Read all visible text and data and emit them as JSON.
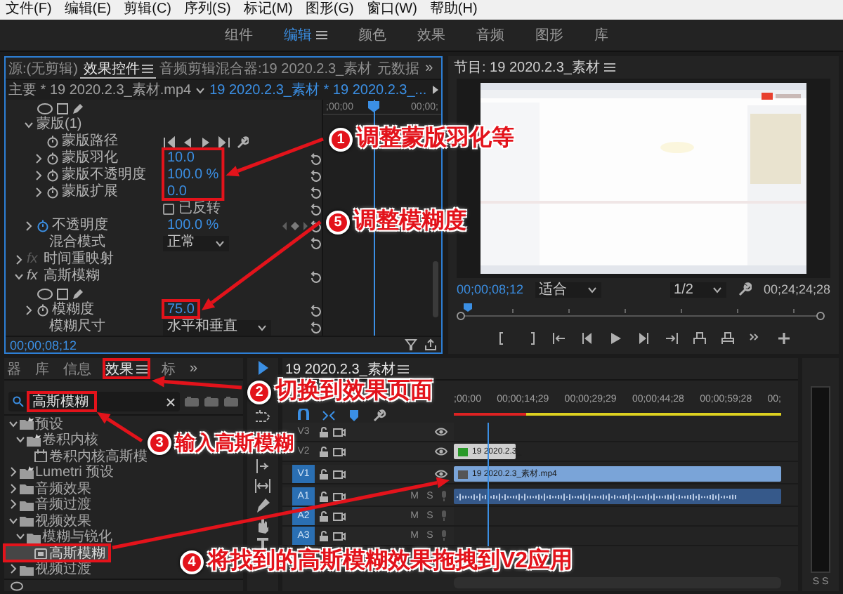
{
  "menu_bar": [
    "文件(F)",
    "编辑(E)",
    "剪辑(C)",
    "序列(S)",
    "标记(M)",
    "图形(G)",
    "窗口(W)",
    "帮助(H)"
  ],
  "workspaces": [
    {
      "label": "组件",
      "selected": false
    },
    {
      "label": "编辑",
      "selected": true
    },
    {
      "label": "颜色",
      "selected": false
    },
    {
      "label": "效果",
      "selected": false
    },
    {
      "label": "音频",
      "selected": false
    },
    {
      "label": "图形",
      "selected": false
    },
    {
      "label": "库",
      "selected": false
    }
  ],
  "effect_controls": {
    "tabs": [
      {
        "label": "源:(无剪辑)",
        "selected": false
      },
      {
        "label": "效果控件",
        "selected": true
      },
      {
        "label": "音频剪辑混合器:19 2020.2.3_素材",
        "selected": false
      },
      {
        "label": "元数据",
        "selected": false
      }
    ],
    "overflow": "»",
    "master_clip": "主要 * 19 2020.2.3_素材.mp4",
    "sequence_clip": "19 2020.2.3_素材 * 19 2020.2.3_...",
    "ruler": [
      ";00;00",
      "00;00;"
    ],
    "effects": [
      {
        "children": [
          {
            "kind": "shapes"
          },
          {
            "kind": "group",
            "label": "蒙版(1)",
            "expanded": true,
            "children": [
              {
                "kind": "keyframes",
                "label": "蒙版路径"
              },
              {
                "kind": "value",
                "label": "蒙版羽化",
                "value": "10.0",
                "expanded": false,
                "animated": false
              },
              {
                "kind": "value",
                "label": "蒙版不透明度",
                "value": "100.0 %",
                "expanded": false,
                "animated": false
              },
              {
                "kind": "value",
                "label": "蒙版扩展",
                "value": "0.0",
                "expanded": false,
                "animated": false
              },
              {
                "kind": "checkbox",
                "label": "已反转",
                "checked": false
              }
            ]
          },
          {
            "kind": "value",
            "label": "不透明度",
            "value": "100.0 %",
            "expanded": false,
            "animated": true
          },
          {
            "kind": "dropdown",
            "label": "混合模式",
            "value": "正常"
          }
        ]
      },
      {
        "badge": "fx",
        "label": "时间重映射",
        "expanded": false,
        "enabled": false
      },
      {
        "badge": "fx",
        "label": "高斯模糊",
        "expanded": true,
        "enabled": true,
        "children": [
          {
            "kind": "shapes"
          },
          {
            "kind": "value",
            "label": "模糊度",
            "value": "75.0",
            "expanded": false,
            "animated": false
          },
          {
            "kind": "dropdown",
            "label": "模糊尺寸",
            "value": "水平和垂直"
          }
        ]
      }
    ],
    "timecode": "00;00;08;12"
  },
  "program_monitor": {
    "title": "节目: 19 2020.2.3_素材",
    "timecode": "00;00;08;12",
    "zoom": "适合",
    "resolution": "1/2",
    "duration": "00;24;24;28"
  },
  "effects_panel": {
    "tabs": [
      {
        "label": "器",
        "selected": false
      },
      {
        "label": "库",
        "selected": false
      },
      {
        "label": "信息",
        "selected": false
      },
      {
        "label": "效果",
        "selected": true
      },
      {
        "label": "标",
        "selected": false
      }
    ],
    "overflow": "»",
    "search": {
      "value": "高斯模糊"
    },
    "tree": [
      {
        "label": "预设",
        "kind": "preset_folder",
        "expanded": true,
        "selected": false,
        "children": [
          {
            "label": "卷积内核",
            "kind": "preset_folder",
            "expanded": true,
            "selected": false,
            "children": [
              {
                "label": "卷积内核高斯模",
                "kind": "preset",
                "selected": false
              }
            ]
          }
        ]
      },
      {
        "label": "Lumetri 预设",
        "kind": "preset_folder",
        "expanded": false,
        "selected": false
      },
      {
        "label": "音频效果",
        "kind": "folder",
        "expanded": false,
        "selected": false
      },
      {
        "label": "音频过渡",
        "kind": "folder",
        "expanded": false,
        "selected": false
      },
      {
        "label": "视频效果",
        "kind": "folder",
        "expanded": true,
        "selected": false,
        "children": [
          {
            "label": "模糊与锐化",
            "kind": "folder",
            "expanded": true,
            "selected": false,
            "children": [
              {
                "label": "高斯模糊",
                "kind": "effect",
                "selected": true
              }
            ]
          }
        ]
      },
      {
        "label": "视频过渡",
        "kind": "folder",
        "expanded": false,
        "selected": false
      }
    ]
  },
  "timeline": {
    "title": "19 2020.2.3_素材",
    "ruler": [
      ";00;00",
      "00;00;14;29",
      "00;00;29;29",
      "00;00;44;28",
      "00;00;59;28",
      "00;"
    ],
    "tracks": [
      {
        "name": "V3",
        "kind": "video",
        "targeted": false
      },
      {
        "name": "V2",
        "kind": "video",
        "targeted": false,
        "clip": {
          "kind": "graphic",
          "label": "19 2020.2.3_"
        }
      },
      {
        "name": "V1",
        "kind": "video",
        "targeted": true,
        "clip": {
          "kind": "video",
          "label": "19 2020.2.3_素材.mp4"
        }
      },
      {
        "name": "A1",
        "kind": "audio",
        "targeted": true,
        "mute": "M",
        "solo": "S",
        "clip": {
          "kind": "audio"
        }
      },
      {
        "name": "A2",
        "kind": "audio",
        "targeted": true,
        "mute": "M",
        "solo": "S"
      },
      {
        "name": "A3",
        "kind": "audio",
        "targeted": true,
        "mute": "M",
        "solo": "S"
      }
    ]
  },
  "audio_meter": {
    "solo_buttons": [
      "S",
      "S"
    ]
  },
  "annotations": [
    {
      "number": "1",
      "text": "调整蒙版羽化等"
    },
    {
      "number": "5",
      "text": "调整模糊度"
    },
    {
      "number": "2",
      "text": "切换到效果页面"
    },
    {
      "number": "3",
      "text": "输入高斯模糊"
    },
    {
      "number": "4",
      "text": "将找到的高斯模糊效果拖拽到V2应用"
    }
  ]
}
